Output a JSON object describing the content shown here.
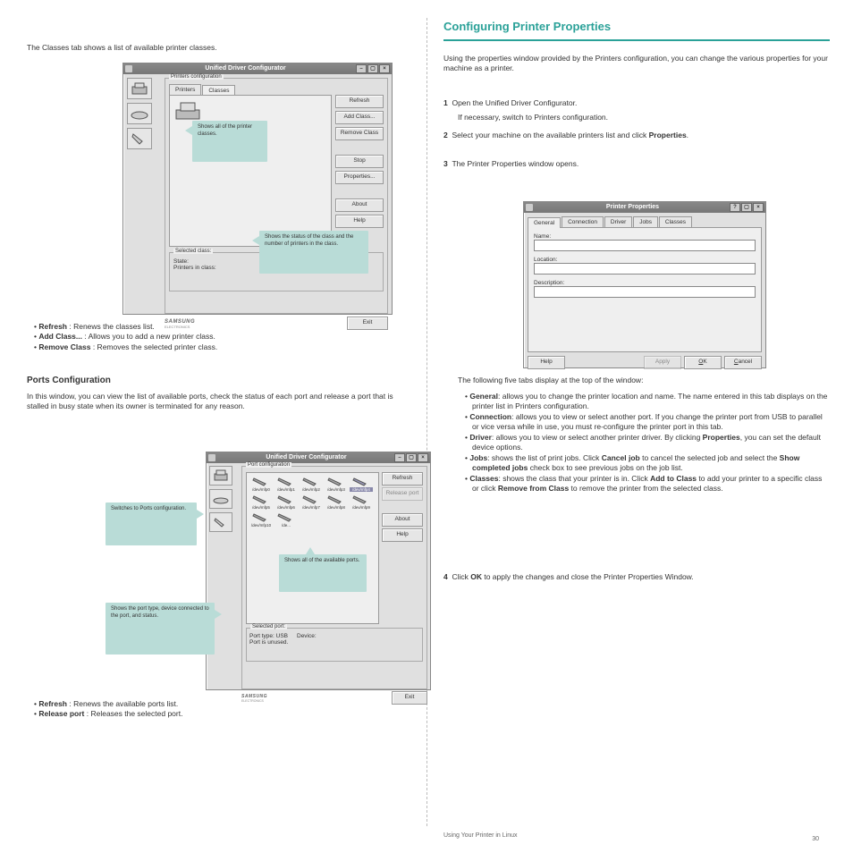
{
  "left_column": {
    "intro": "The Classes tab shows a list of available printer classes.",
    "dialog1": {
      "title": "Unified Driver Configurator",
      "group_label": "Printers configuration",
      "tabs": {
        "printers": "Printers",
        "classes": "Classes"
      },
      "buttons": {
        "refresh": "Refresh",
        "add_class": "Add Class...",
        "remove_class": "Remove Class",
        "stop": "Stop",
        "properties": "Properties...",
        "about": "About",
        "help": "Help",
        "exit": "Exit"
      },
      "selected_class": {
        "label": "Selected class:",
        "state_label": "State:",
        "printers_label": "Printers in class:"
      },
      "brand": "SAMSUNG",
      "brand_sub": "ELECTRONICS"
    },
    "callout1": "Shows all of the printer classes.",
    "callout2": "Shows the status of the class and the number of printers in the class.",
    "bullets1": [
      "Refresh : Renews the classes list.",
      "Add Class... : Allows you to add a new printer class.",
      "Remove Class : Removes the selected printer class."
    ],
    "ports_heading": "Ports Configuration",
    "ports_intro": "In this window, you can view the list of available ports, check the status of each port and release a port that is stalled in busy state when its owner is terminated for any reason.",
    "dialog2": {
      "title": "Unified Driver Configurator",
      "group_label": "Port configuration",
      "buttons": {
        "refresh": "Refresh",
        "release": "Release port",
        "about": "About",
        "help": "Help",
        "exit": "Exit"
      },
      "ports": [
        "/dev/mfp0",
        "/dev/mfp1",
        "/dev/mfp2",
        "/dev/mfp3",
        "/dev/mfp4",
        "/dev/mfp5",
        "/dev/mfp6",
        "/dev/mfp7",
        "/dev/mfp8",
        "/dev/mfp9",
        "/dev/mfp10",
        "/de..."
      ],
      "selected_port": {
        "label": "Selected port:",
        "type_label": "Port type: USB",
        "device_label": "Device:",
        "status_label": "Port is unused."
      },
      "brand": "SAMSUNG",
      "brand_sub": "ELECTRONICS"
    },
    "callout3": "Switches to Ports configuration.",
    "callout4": "Shows the port type, device connected to the port, and status.",
    "callout5": "Shows all of the available ports.",
    "bullets2": [
      "Refresh : Renews the available ports list.",
      "Release port : Releases the selected port."
    ]
  },
  "right_column": {
    "heading": "Configuring Printer Properties",
    "intro": "Using the properties window provided by the Printers configuration, you can change the various properties for your machine as a printer.",
    "step1_num": "1",
    "step1_text": "Open the Unified Driver Configurator.",
    "step1_sub": "If necessary, switch to Printers configuration.",
    "step2_num": "2",
    "step2_text": "Select your machine on the available printers list and click Properties.",
    "step3_num": "3",
    "step3_text": "The Printer Properties window opens.",
    "dialog3": {
      "title": "Printer Properties",
      "tabs": {
        "general": "General",
        "connection": "Connection",
        "driver": "Driver",
        "jobs": "Jobs",
        "classes": "Classes"
      },
      "fields": {
        "name": "Name:",
        "location": "Location:",
        "description": "Description:"
      },
      "buttons": {
        "help": "Help",
        "apply": "Apply",
        "ok": "OK",
        "cancel": "Cancel"
      }
    },
    "tabs_intro": "The following five tabs display at the top of the window:",
    "tab_desc": [
      "General: allows you to change the printer location and name. The name entered in this tab displays on the printer list in Printers configuration.",
      "Connection: allows you to view or select another port. If you change the printer port from USB to parallel or vice versa while in use, you must re-configure the printer port in this tab.",
      "Driver: allows you to view or select another printer driver. By clicking Properties, you can set the default device options.",
      "Jobs: shows the list of print jobs. Click Cancel job to cancel the selected job and select the Show completed jobs check box to see previous jobs on the job list.",
      "Classes: shows the class that your printer is in. Click Add to Class to add your printer to a specific class or click Remove from Class to remove the printer from the selected class."
    ],
    "step4_num": "4",
    "step4_text": "Click OK to apply the changes and close the Printer Properties Window."
  },
  "footer": {
    "text": "Using Your Printer in Linux",
    "page": "30"
  }
}
